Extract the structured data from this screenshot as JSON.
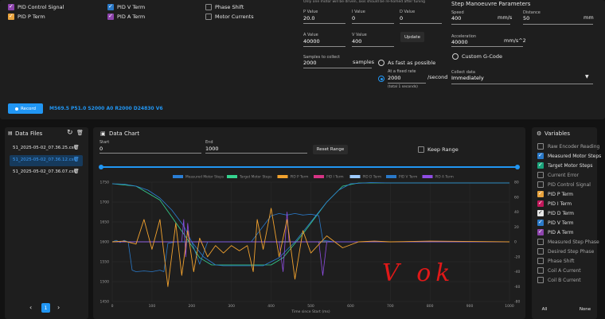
{
  "top_checkboxes": [
    {
      "label": "PID Control Signal",
      "checked": true,
      "color": "#8e44ad"
    },
    {
      "label": "PID P Term",
      "checked": true,
      "color": "#e8a33d"
    },
    {
      "label": "PID V Term",
      "checked": true,
      "color": "#2a79c8"
    },
    {
      "label": "PID A Term",
      "checked": true,
      "color": "#8e44ad"
    },
    {
      "label": "Phase Shift",
      "checked": false
    },
    {
      "label": "Motor Currents",
      "checked": false
    }
  ],
  "pid": {
    "note": "Only one motor will be driven, axis should be re-homed after tuning",
    "p_label": "P Value",
    "p_value": "20.0",
    "i_label": "I Value",
    "i_value": "0",
    "d_label": "D Value",
    "d_value": "0",
    "a_label": "A Value",
    "a_value": "40000",
    "v_label": "V Value",
    "v_value": "400",
    "update_label": "Update",
    "samples_label": "Samples to collect",
    "samples_value": "2000",
    "samples_unit": "samples"
  },
  "rate": {
    "fast_label": "As fast as possible",
    "fixed_label": "At a fixed rate",
    "fixed_value": "2000",
    "fixed_unit": "/second",
    "fixed_hint": "(total 1 seconds)",
    "selected": "fixed"
  },
  "manoeuvre": {
    "title": "Step Manoeuvre Parameters",
    "speed_label": "Speed",
    "speed_value": "400",
    "speed_unit": "mm/s",
    "distance_label": "Distance",
    "distance_value": "50",
    "distance_unit": "mm",
    "accel_label": "Acceleration",
    "accel_value": "40000",
    "accel_unit": "mm/s^2",
    "custom_label": "Custom G-Code",
    "collect_label": "Collect data",
    "collect_value": "Immediately"
  },
  "record": {
    "button_label": "Record",
    "command": "M569.5 P51.0 S2000 A0 R2000 D24830 V6"
  },
  "data_files": {
    "title": "Data Files",
    "files": [
      {
        "name": "51_2025-05-02_07.36.25.csv",
        "selected": false
      },
      {
        "name": "51_2025-05-02_07.36.12.csv",
        "selected": true
      },
      {
        "name": "51_2025-05-02_07.36.07.csv",
        "selected": false
      }
    ],
    "page": "1"
  },
  "chart_panel": {
    "title": "Data Chart",
    "start_label": "Start",
    "start_value": "0",
    "end_label": "End",
    "end_value": "1000",
    "reset_label": "Reset Range",
    "keep_label": "Keep Range",
    "handwriting": "V ok"
  },
  "variables": {
    "title": "Variables",
    "items": [
      {
        "label": "Raw Encoder Reading",
        "checked": false
      },
      {
        "label": "Measured Motor Steps",
        "checked": true,
        "color": "#2a79c8"
      },
      {
        "label": "Target Motor Steps",
        "checked": true,
        "color": "#1aa37a"
      },
      {
        "label": "Current Error",
        "checked": false
      },
      {
        "label": "PID Control Signal",
        "checked": false
      },
      {
        "label": "PID P Term",
        "checked": true,
        "color": "#e8a33d"
      },
      {
        "label": "PID I Term",
        "checked": true,
        "color": "#c2185b"
      },
      {
        "label": "PID D Term",
        "checked": true,
        "color": "#e6e6e6"
      },
      {
        "label": "PID V Term",
        "checked": true,
        "color": "#2a79c8"
      },
      {
        "label": "PID A Term",
        "checked": true,
        "color": "#8e44ad"
      },
      {
        "label": "Measured Step Phase",
        "checked": false
      },
      {
        "label": "Desired Step Phase",
        "checked": false
      },
      {
        "label": "Phase Shift",
        "checked": false
      },
      {
        "label": "Coil A Current",
        "checked": false
      },
      {
        "label": "Coil B Current",
        "checked": false
      }
    ],
    "all_label": "All",
    "none_label": "None"
  },
  "chart_data": {
    "type": "line",
    "xlabel": "Time since Start (ms)",
    "x_ticks": [
      "0",
      "100",
      "200",
      "300",
      "400",
      "500",
      "600",
      "700",
      "800",
      "900",
      "1000"
    ],
    "y_left_ticks": [
      "1750",
      "1700",
      "1650",
      "1600",
      "1550",
      "1500",
      "1450"
    ],
    "y_right_ticks": [
      "80",
      "60",
      "40",
      "20",
      "0",
      "-20",
      "-40",
      "-60",
      "-80"
    ],
    "xlim": [
      0,
      1000
    ],
    "ylim_left": [
      1450,
      1750
    ],
    "ylim_right": [
      -80,
      80
    ],
    "legend_position": "top",
    "series": [
      {
        "name": "Measured Motor Steps",
        "color": "#2a7fd6",
        "axis": "left",
        "points": [
          [
            0,
            1746
          ],
          [
            30,
            1745
          ],
          [
            60,
            1740
          ],
          [
            90,
            1730
          ],
          [
            120,
            1710
          ],
          [
            150,
            1680
          ],
          [
            180,
            1640
          ],
          [
            200,
            1600
          ],
          [
            230,
            1562
          ],
          [
            260,
            1542
          ],
          [
            280,
            1540
          ],
          [
            330,
            1540
          ],
          [
            380,
            1540
          ],
          [
            420,
            1560
          ],
          [
            460,
            1600
          ],
          [
            500,
            1650
          ],
          [
            540,
            1700
          ],
          [
            570,
            1730
          ],
          [
            600,
            1746
          ],
          [
            650,
            1749
          ],
          [
            700,
            1748
          ],
          [
            800,
            1748
          ],
          [
            900,
            1748
          ],
          [
            1000,
            1748
          ]
        ]
      },
      {
        "name": "Target Motor Steps",
        "color": "#35d38f",
        "axis": "left",
        "points": [
          [
            0,
            1746
          ],
          [
            60,
            1740
          ],
          [
            120,
            1705
          ],
          [
            180,
            1620
          ],
          [
            220,
            1560
          ],
          [
            250,
            1542
          ],
          [
            400,
            1542
          ],
          [
            430,
            1560
          ],
          [
            480,
            1620
          ],
          [
            540,
            1700
          ],
          [
            580,
            1740
          ],
          [
            620,
            1748
          ],
          [
            1000,
            1748
          ]
        ]
      },
      {
        "name": "PID P Term",
        "color": "#f2a22e",
        "axis": "right",
        "points": [
          [
            0,
            0
          ],
          [
            30,
            1
          ],
          [
            60,
            -3
          ],
          [
            80,
            30
          ],
          [
            100,
            -10
          ],
          [
            120,
            30
          ],
          [
            140,
            -60
          ],
          [
            160,
            25
          ],
          [
            175,
            -45
          ],
          [
            190,
            15
          ],
          [
            205,
            -40
          ],
          [
            220,
            5
          ],
          [
            240,
            -20
          ],
          [
            260,
            -5
          ],
          [
            280,
            -15
          ],
          [
            300,
            -5
          ],
          [
            320,
            -12
          ],
          [
            340,
            -5
          ],
          [
            355,
            -40
          ],
          [
            365,
            30
          ],
          [
            380,
            -10
          ],
          [
            400,
            45
          ],
          [
            420,
            -20
          ],
          [
            440,
            30
          ],
          [
            460,
            -50
          ],
          [
            480,
            15
          ],
          [
            500,
            -15
          ],
          [
            540,
            8
          ],
          [
            580,
            -8
          ],
          [
            620,
            0
          ],
          [
            660,
            1
          ],
          [
            700,
            0
          ],
          [
            800,
            1
          ],
          [
            1000,
            0
          ]
        ]
      },
      {
        "name": "PID I Term",
        "color": "#d63384",
        "axis": "right",
        "points": [
          [
            0,
            0
          ],
          [
            1000,
            0
          ]
        ]
      },
      {
        "name": "PID D Term",
        "color": "#9ecbff",
        "axis": "right",
        "points": [
          [
            0,
            0
          ],
          [
            1000,
            0
          ]
        ]
      },
      {
        "name": "PID V Term",
        "color": "#2a79c8",
        "axis": "right",
        "points": [
          [
            0,
            0
          ],
          [
            10,
            2
          ],
          [
            20,
            -1
          ],
          [
            30,
            2
          ],
          [
            40,
            0
          ],
          [
            50,
            -38
          ],
          [
            60,
            -40
          ],
          [
            80,
            -39
          ],
          [
            100,
            -40
          ],
          [
            120,
            -38
          ],
          [
            130,
            -40
          ],
          [
            140,
            -2
          ],
          [
            160,
            0
          ],
          [
            200,
            0
          ],
          [
            220,
            -30
          ],
          [
            240,
            0
          ],
          [
            300,
            0
          ],
          [
            350,
            0
          ],
          [
            400,
            35
          ],
          [
            420,
            38
          ],
          [
            440,
            36
          ],
          [
            460,
            38
          ],
          [
            480,
            36
          ],
          [
            500,
            37
          ],
          [
            520,
            35
          ],
          [
            530,
            2
          ],
          [
            560,
            0
          ],
          [
            1000,
            0
          ]
        ]
      },
      {
        "name": "PID A Term",
        "color": "#8f4de3",
        "axis": "right",
        "points": [
          [
            0,
            0
          ],
          [
            175,
            0
          ],
          [
            180,
            30
          ],
          [
            185,
            -20
          ],
          [
            190,
            25
          ],
          [
            195,
            0
          ],
          [
            420,
            0
          ],
          [
            430,
            -40
          ],
          [
            440,
            40
          ],
          [
            445,
            0
          ],
          [
            520,
            0
          ],
          [
            530,
            -45
          ],
          [
            540,
            0
          ],
          [
            1000,
            0
          ]
        ]
      }
    ]
  }
}
